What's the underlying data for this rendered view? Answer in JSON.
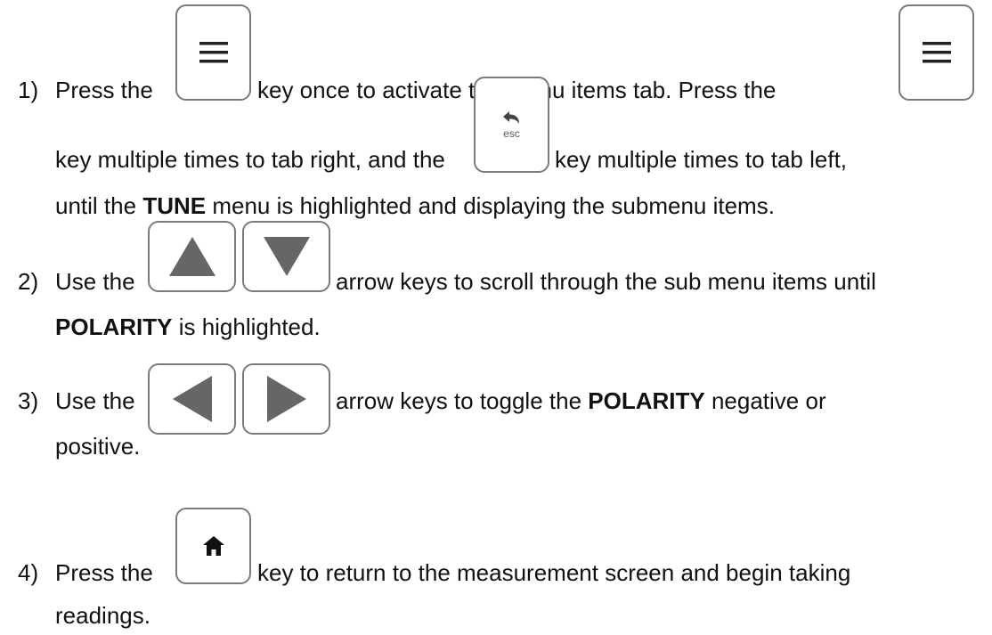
{
  "steps": [
    {
      "number": "1)",
      "l1a": "Press the",
      "l1b": "key once to activate the menu items tab.  Press the",
      "l2a": "key multiple times to tab right, and the",
      "l2b": "key multiple times to tab left,",
      "l3a": "until the",
      "l3bold": "TUNE",
      "l3b": "menu is highlighted and displaying the submenu items."
    },
    {
      "number": "2)",
      "l1a": "Use the",
      "l1b": "arrow keys to scroll through the sub menu items until",
      "l2bold": "POLARITY",
      "l2b": "is highlighted."
    },
    {
      "number": "3)",
      "l1a": "Use the",
      "l1b": "arrow keys to toggle the",
      "l1bold": "POLARITY",
      "l1c": "negative or",
      "l2": "positive."
    },
    {
      "number": "4)",
      "l1a": "Press the",
      "l1b": "key to return to the measurement screen and begin taking",
      "l2": "readings."
    }
  ],
  "keys": {
    "esc_label": "esc",
    "menu_icon": "menu-icon",
    "back_icon": "back-arrow-icon",
    "up_icon": "triangle-up-icon",
    "down_icon": "triangle-down-icon",
    "left_icon": "triangle-left-icon",
    "right_icon": "triangle-right-icon",
    "home_icon": "home-icon"
  }
}
